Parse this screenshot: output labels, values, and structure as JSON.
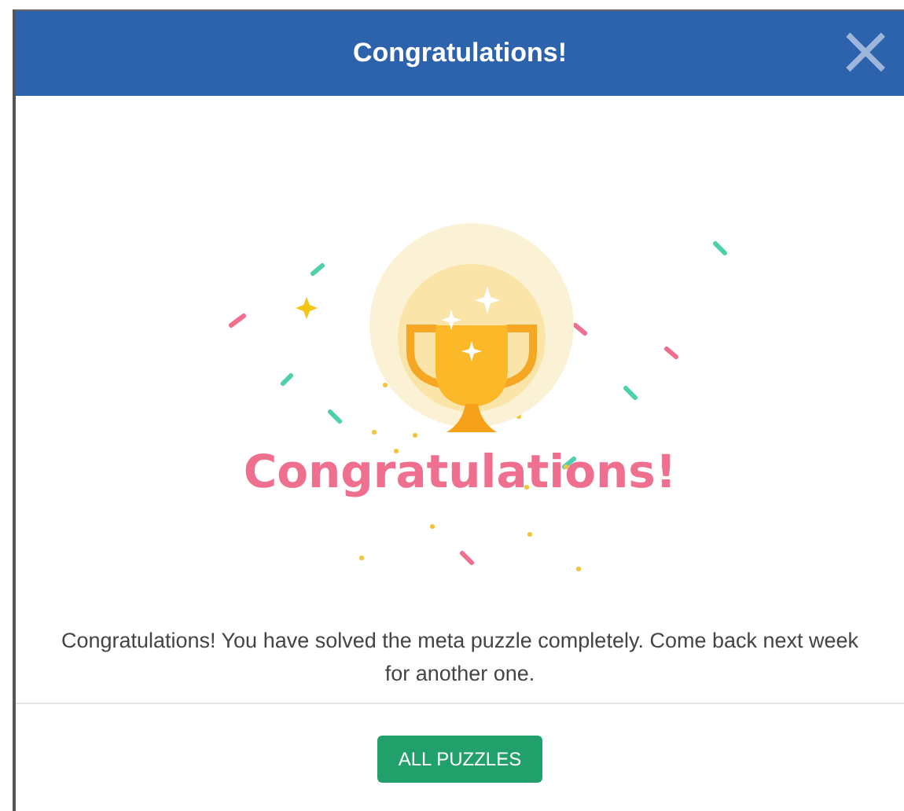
{
  "dialog": {
    "title": "Congratulations!",
    "close": "×"
  },
  "illustration": {
    "heading": "Congratulations!"
  },
  "message": "Congratulations! You have solved the meta puzzle completely. Come back next week for another one.",
  "buttons": [
    "ALL PUZZLES"
  ]
}
